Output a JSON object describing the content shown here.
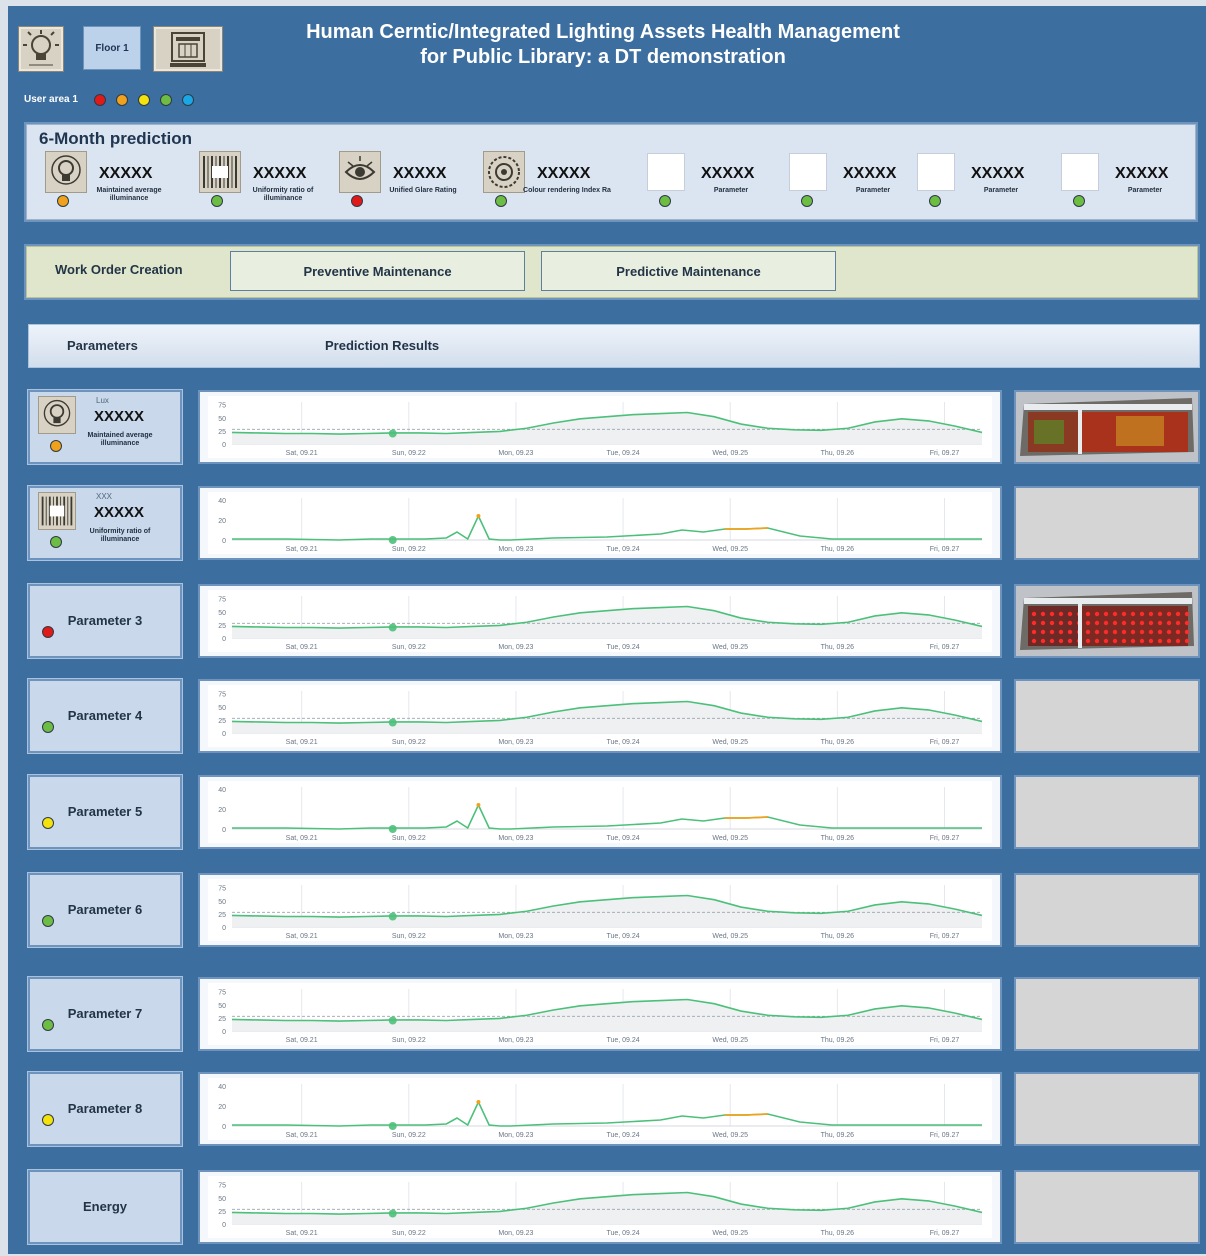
{
  "header": {
    "title_line1": "Human Cerntic/Integrated Lighting Assets Health Management",
    "title_line2": "for Public Library: a DT demonstration",
    "floor_button": "Floor 1",
    "user_area_label": "User area 1",
    "user_area_dots": [
      "#e01919",
      "#f0a21c",
      "#f3e20b",
      "#6dbd45",
      "#1aa7e6"
    ],
    "bulb_icon": "light-bulb-icon",
    "book_icon": "book-return-icon"
  },
  "prediction": {
    "title": "6-Month prediction",
    "kpis": [
      {
        "value": "XXXXX",
        "label": "Maintained average illuminance",
        "icon": "light-bulb-icon",
        "status": "#f0a21c"
      },
      {
        "value": "XXXXX",
        "label": "Uniformity ratio of illuminance",
        "icon": "uniformity-grid-icon",
        "status": "#6dbd45"
      },
      {
        "value": "XXXXX",
        "label": "Unified Glare Rating",
        "icon": "eye-icon",
        "status": "#e01919"
      },
      {
        "value": "XXXXX",
        "label": "Colour rendering Index Ra",
        "icon": "color-wheel-icon",
        "status": "#6dbd45"
      },
      {
        "value": "XXXXX",
        "label": "Parameter",
        "icon": "blank-icon",
        "status": "#6dbd45"
      },
      {
        "value": "XXXXX",
        "label": "Parameter",
        "icon": "blank-icon",
        "status": "#6dbd45"
      },
      {
        "value": "XXXXX",
        "label": "Parameter",
        "icon": "blank-icon",
        "status": "#6dbd45"
      },
      {
        "value": "XXXXX",
        "label": "Parameter",
        "icon": "blank-icon",
        "status": "#6dbd45"
      }
    ]
  },
  "work_order": {
    "label": "Work Order Creation",
    "preventive": "Preventive Maintenance",
    "predictive": "Predictive Maintenance"
  },
  "table_header": {
    "parameters": "Parameters",
    "results": "Prediction Results"
  },
  "rows": [
    {
      "name": "",
      "unit": "Lux",
      "value": "XXXXX",
      "desc": "Maintained average illuminance",
      "icon": "light-bulb-icon",
      "status": "#f0a21c",
      "chart": "a",
      "thumb": "heatmap-render"
    },
    {
      "name": "",
      "unit": "XXX",
      "value": "XXXXX",
      "desc": "Uniformity ratio of illuminance",
      "icon": "uniformity-grid-icon",
      "status": "#6dbd45",
      "chart": "b",
      "thumb": "empty"
    },
    {
      "name": "Parameter 3",
      "status": "#e01919",
      "chart": "a",
      "thumb": "red-lights-render"
    },
    {
      "name": "Parameter 4",
      "status": "#6dbd45",
      "chart": "a",
      "thumb": "empty"
    },
    {
      "name": "Parameter 5",
      "status": "#f3e20b",
      "chart": "b",
      "thumb": "empty"
    },
    {
      "name": "Parameter 6",
      "status": "#6dbd45",
      "chart": "a",
      "thumb": "empty"
    },
    {
      "name": "Parameter 7",
      "status": "#6dbd45",
      "chart": "a",
      "thumb": "empty"
    },
    {
      "name": "Parameter 8",
      "status": "#f3e20b",
      "chart": "b",
      "thumb": "empty"
    },
    {
      "name": "Energy",
      "chart": "a",
      "thumb": "empty"
    }
  ],
  "chart_data": [
    {
      "type": "area",
      "id": "a",
      "x_ticks": [
        "Sat, 09.21",
        "Sun, 09.22",
        "Mon, 09.23",
        "Tue, 09.24",
        "Wed, 09.25",
        "Thu, 09.26",
        "Fri, 09.27"
      ],
      "y_ticks": [
        0,
        25,
        50,
        75
      ],
      "ylim": [
        0,
        80
      ],
      "threshold": 28,
      "line_color": "#4cc07a",
      "x": [
        0,
        0.25,
        0.5,
        0.75,
        1,
        1.25,
        1.5,
        1.75,
        2,
        2.25,
        2.5,
        2.75,
        3,
        3.25,
        3.5,
        3.75,
        4,
        4.25,
        4.5,
        4.75,
        5,
        5.25,
        5.5,
        5.75,
        6,
        6.25,
        6.5,
        6.75,
        7
      ],
      "values": [
        22,
        21,
        20,
        20,
        19,
        20,
        21,
        21,
        20,
        22,
        24,
        30,
        40,
        48,
        52,
        56,
        58,
        60,
        52,
        38,
        30,
        27,
        26,
        30,
        42,
        48,
        44,
        34,
        22
      ],
      "marker": {
        "x": 1.5,
        "y": 20
      },
      "x_start_offset": 0.6
    },
    {
      "type": "line",
      "id": "b",
      "x_ticks": [
        "Sat, 09.21",
        "Sun, 09.22",
        "Mon, 09.23",
        "Tue, 09.24",
        "Wed, 09.25",
        "Thu, 09.26",
        "Fri, 09.27"
      ],
      "y_ticks": [
        0,
        20,
        40
      ],
      "ylim": [
        0,
        42
      ],
      "line_color": "#4cc07a",
      "x": [
        0,
        0.5,
        1,
        1.3,
        1.5,
        1.8,
        2.0,
        2.1,
        2.2,
        2.3,
        2.4,
        2.5,
        2.6,
        2.8,
        3,
        3.5,
        4,
        4.2,
        4.4,
        4.6,
        4.8,
        5.0,
        5.3,
        5.6,
        6,
        6.5,
        7
      ],
      "values": [
        1,
        1,
        0,
        1,
        1,
        1,
        2,
        8,
        1,
        24,
        1,
        0,
        0,
        1,
        2,
        3,
        6,
        10,
        8,
        11,
        11,
        12,
        4,
        1,
        1,
        1,
        1
      ],
      "highlight": [
        {
          "x1": 2.25,
          "x2": 2.35,
          "color": "#f0a21c"
        },
        {
          "x1": 4.55,
          "x2": 5.05,
          "color": "#f0a21c"
        }
      ],
      "marker": {
        "x": 1.5,
        "y": 0
      }
    }
  ]
}
